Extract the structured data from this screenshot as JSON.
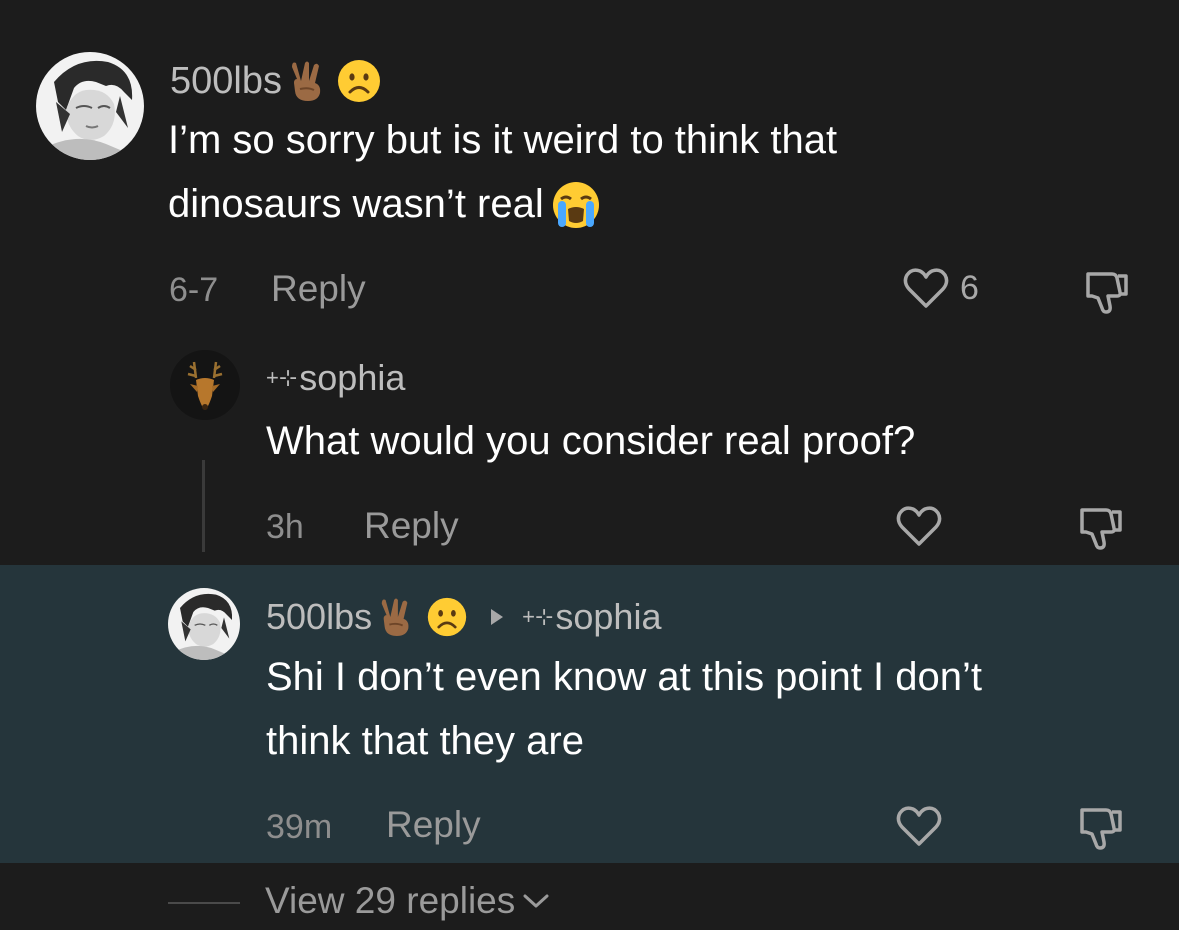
{
  "comments": [
    {
      "username": "500lbs",
      "text_lines": [
        "I’m so sorry but is it weird to think that",
        "dinosaurs wasn’t real"
      ],
      "time": "6-7",
      "reply_label": "Reply",
      "like_count": "6",
      "icons": [
        "victory-hand-icon",
        "frowning-face-icon",
        "loudly-crying-face-icon"
      ]
    },
    {
      "username_prefix": "+⊹",
      "username": "sophia",
      "text_lines": [
        "What would you consider real proof?"
      ],
      "time": "3h",
      "reply_label": "Reply"
    },
    {
      "username": "500lbs",
      "reply_to_prefix": "+⊹",
      "reply_to": "sophia",
      "text_lines": [
        "Shi I don’t even know at this point I don’t",
        "think that they are"
      ],
      "time": "39m",
      "reply_label": "Reply",
      "highlight_color": "#25353b"
    }
  ],
  "view_replies": "View 29 replies",
  "colors": {
    "background": "#1c1c1c",
    "text": "#ffffff",
    "muted": "#9a9a9a"
  }
}
